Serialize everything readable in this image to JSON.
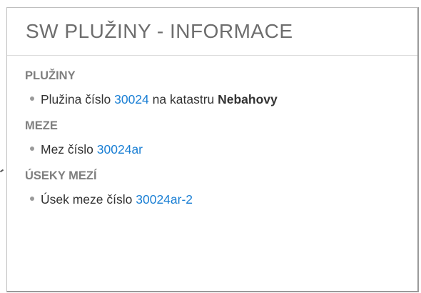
{
  "panel": {
    "title": "SW PLUŽINY - INFORMACE"
  },
  "sections": {
    "pluziny": {
      "heading": "PLUŽINY",
      "item_prefix": "Plužina číslo",
      "item_link": "30024",
      "item_middle": "na katastru",
      "item_bold": "Nebahovy"
    },
    "meze": {
      "heading": "MEZE",
      "item_prefix": "Mez číslo",
      "item_link": "30024ar"
    },
    "useky_mezi": {
      "heading": "ÚSEKY MEZÍ",
      "item_prefix": "Úsek meze číslo",
      "item_link": "30024ar-2"
    }
  },
  "colors": {
    "link": "#1a7fd4",
    "heading": "#7f7f7f",
    "title": "#6d6d6d",
    "text": "#333333"
  }
}
